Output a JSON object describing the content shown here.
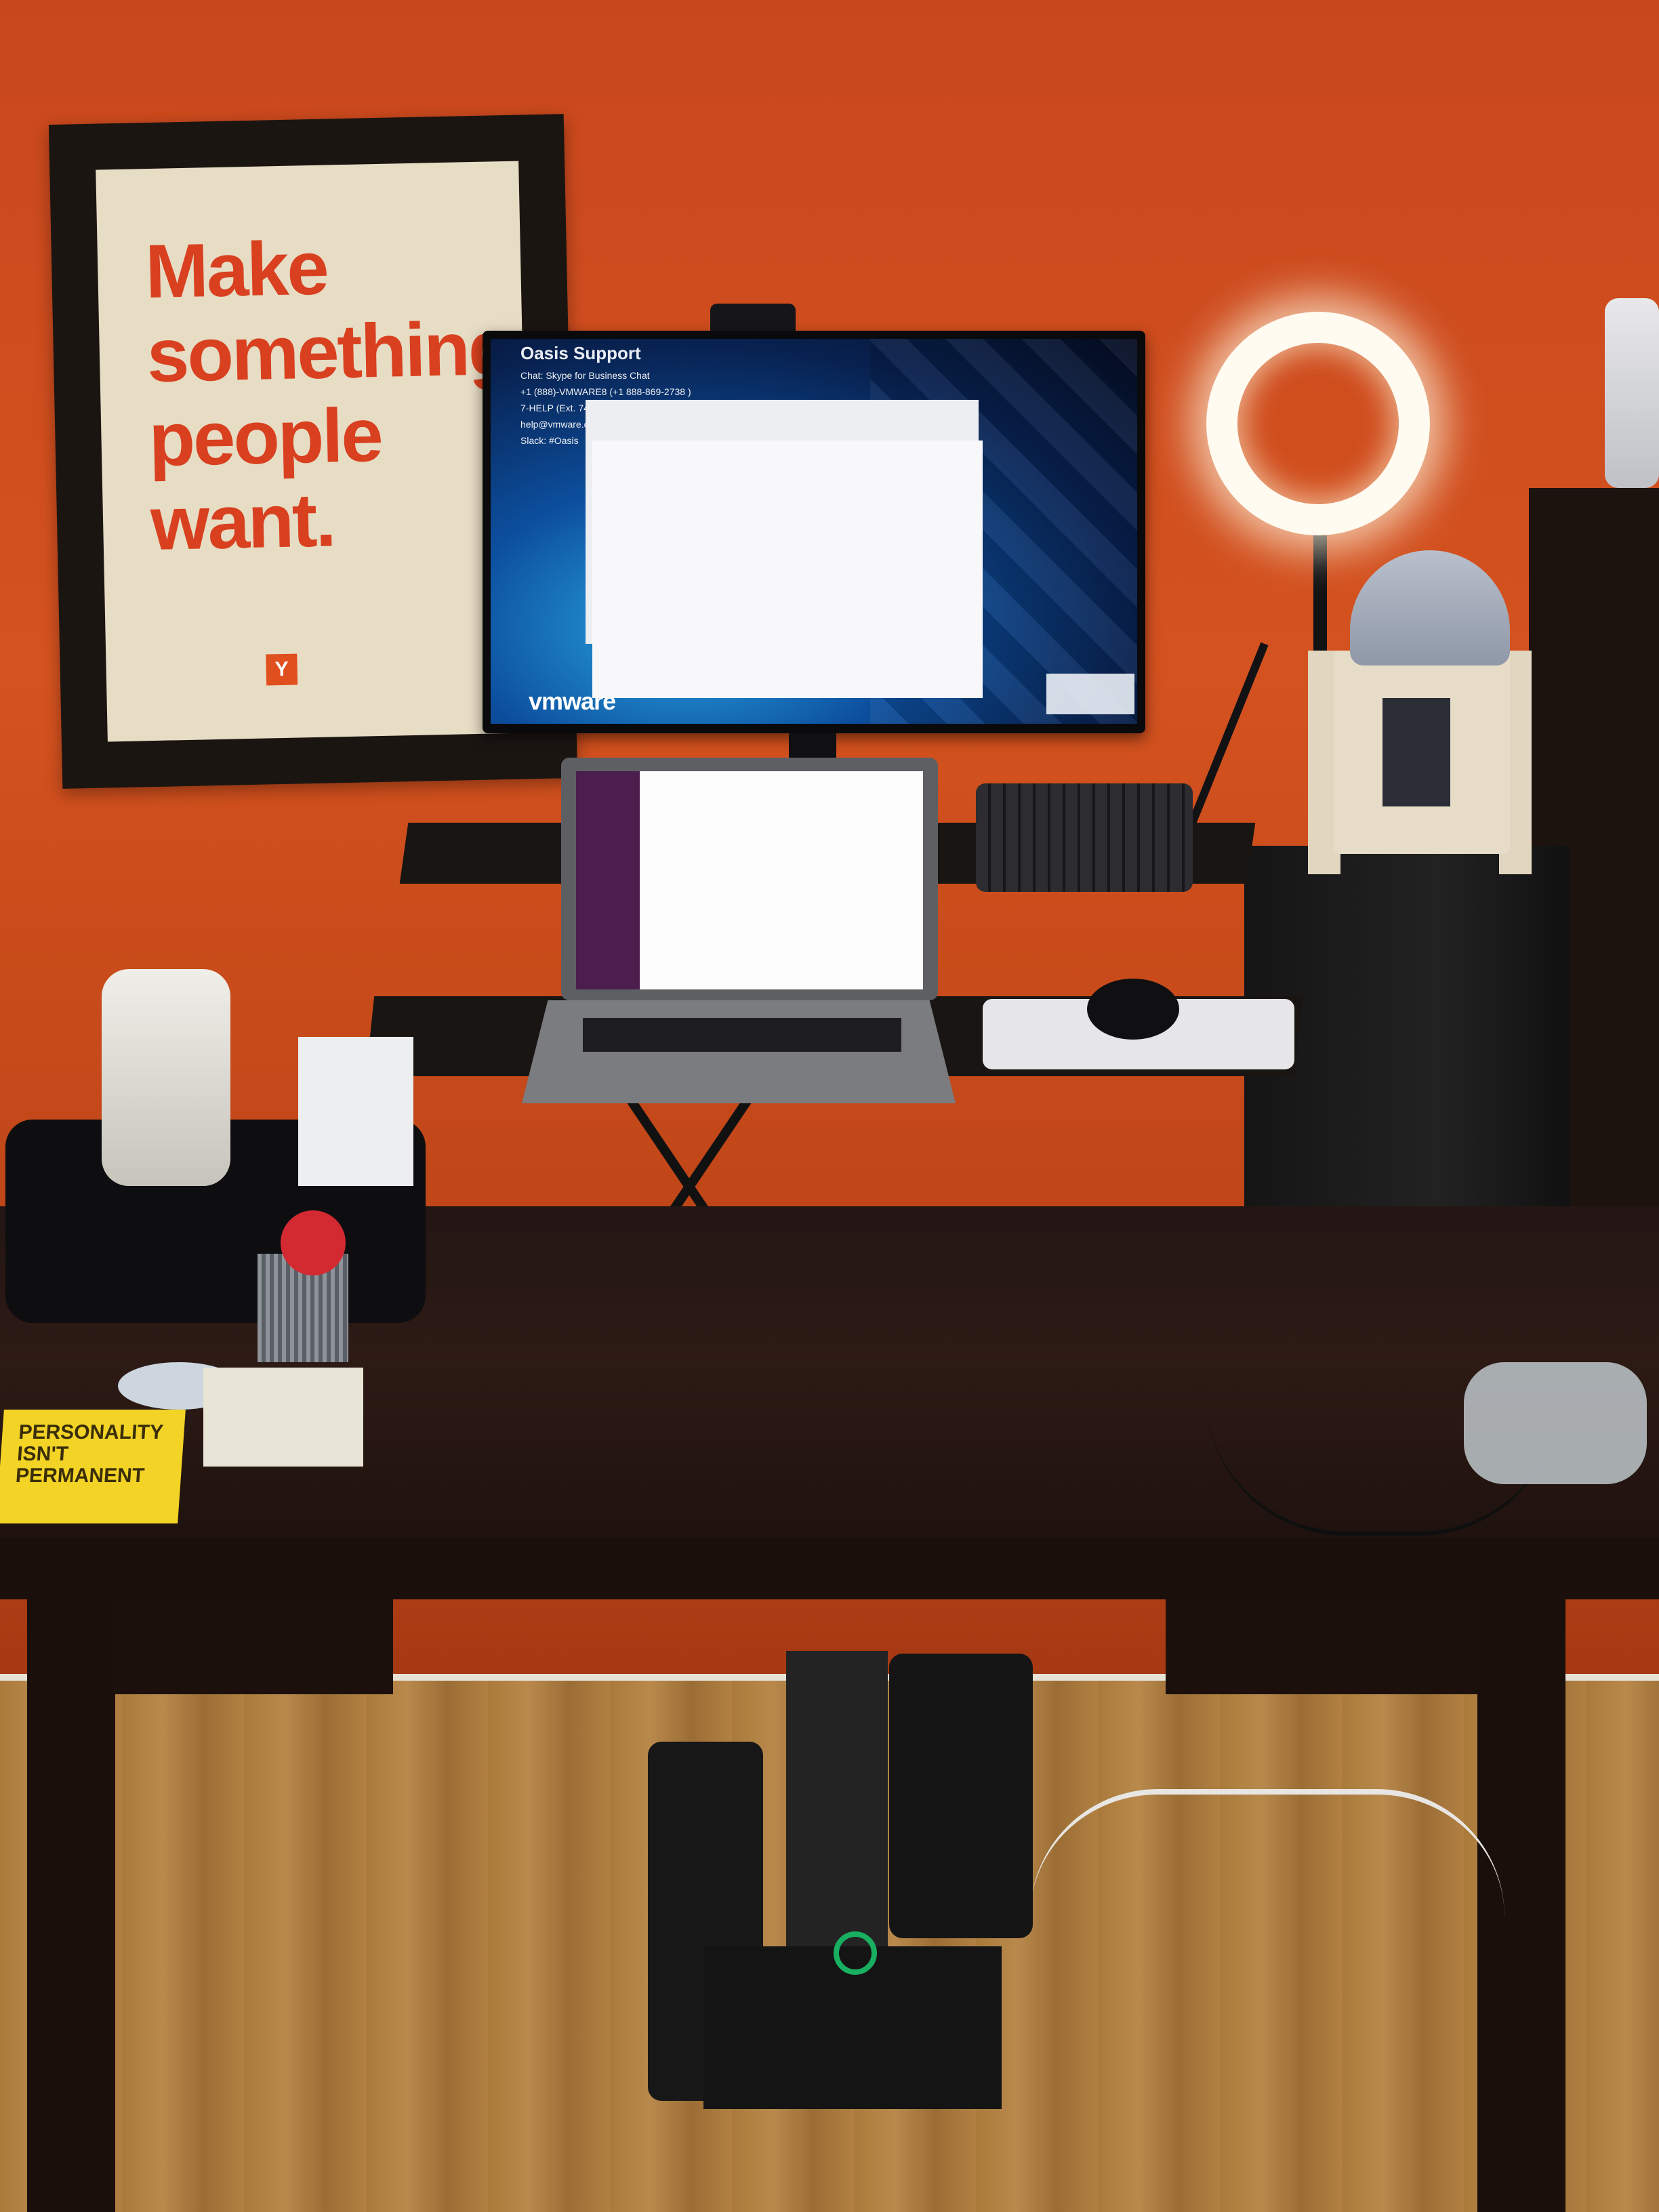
{
  "poster": {
    "lines": [
      "Make",
      "something",
      "people",
      "want."
    ],
    "logo": "Y"
  },
  "monitor": {
    "info": {
      "title": "Oasis Support",
      "lines": [
        "Chat: Skype for Business Chat",
        "+1 (888)-VMWARE8 (+1 888-869-2738 )",
        "7-HELP (Ext. 74357)",
        "help@vmware.com",
        "Slack: #Oasis"
      ]
    },
    "brand": "vmware"
  },
  "book": {
    "title_lines": [
      "PERSONALITY",
      "ISN'T",
      "PERMANENT"
    ]
  },
  "colors": {
    "wall": "#c9471d",
    "poster_text": "#d8401f",
    "ring_light": "#fffbf1",
    "slack_sidebar": "#4c1e4d",
    "book": "#f3d325"
  }
}
